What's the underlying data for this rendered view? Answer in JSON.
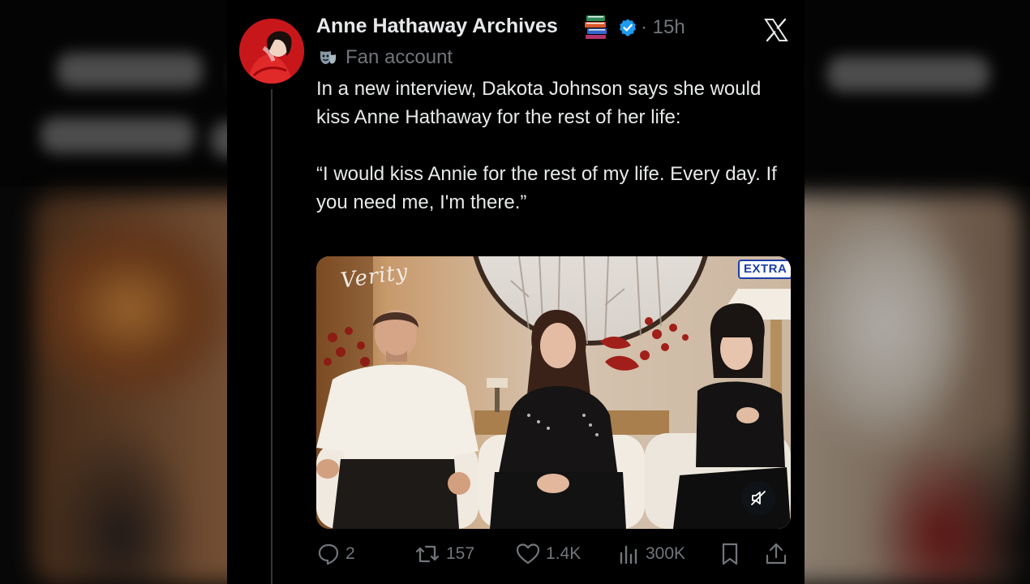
{
  "tweet": {
    "display_name": "Anne Hathaway Archives",
    "timestamp": "· 15h",
    "account_label": "Fan account",
    "text_line1": "In a new interview, Dakota Johnson says she would kiss Anne Hathaway for the rest of her life:",
    "quote": "“I would kiss Annie for the rest of my life. Every day. If you need me, I'm there.”",
    "icons": {
      "name_emoji": "books-icon",
      "verified": "verified-badge-icon",
      "account_label": "performing-arts-mask-icon",
      "platform": "x-logo-icon"
    },
    "colors": {
      "verified": "#1d9bf0",
      "muted_text": "#71767b",
      "text": "#e7e9ea"
    }
  },
  "video": {
    "title_overlay": "Verity",
    "network_logo": "EXTRA",
    "mute_icon": "speaker-muted-icon"
  },
  "actions": {
    "replies": "2",
    "reposts": "157",
    "likes": "1.4K",
    "views": "300K"
  }
}
